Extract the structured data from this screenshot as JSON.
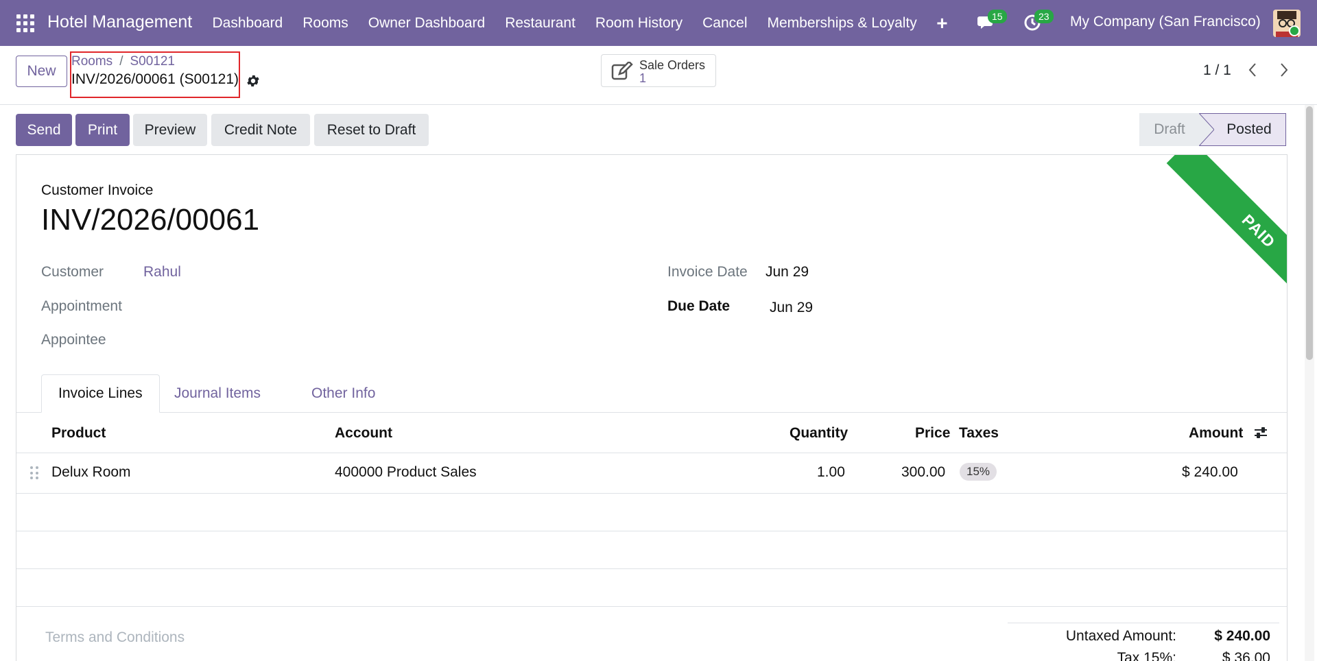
{
  "navbar": {
    "brand": "Hotel Management",
    "menu": [
      "Dashboard",
      "Rooms",
      "Owner Dashboard",
      "Restaurant",
      "Room History",
      "Cancel",
      "Memberships & Loyalty"
    ],
    "plus": "+",
    "messages_count": "15",
    "activities_count": "23",
    "company": "My Company (San Francisco)"
  },
  "control": {
    "new_label": "New",
    "breadcrumb": [
      "Rooms",
      "S00121"
    ],
    "record_title": "INV/2026/00061 (S00121)",
    "smart_button": {
      "label": "Sale Orders",
      "value": "1"
    },
    "pager": "1 / 1"
  },
  "actions": {
    "send": "Send",
    "print": "Print",
    "preview": "Preview",
    "credit_note": "Credit Note",
    "reset_to_draft": "Reset to Draft"
  },
  "status": {
    "draft": "Draft",
    "posted": "Posted",
    "active": "Posted"
  },
  "form": {
    "ribbon": "PAID",
    "doc_type": "Customer Invoice",
    "doc_number": "INV/2026/00061",
    "fields_left": [
      {
        "label": "Customer",
        "value": "Rahul"
      },
      {
        "label": "Appointment",
        "value": ""
      },
      {
        "label": "Appointee",
        "value": ""
      }
    ],
    "fields_right": [
      {
        "label": "Invoice Date",
        "value": "Jun 29"
      },
      {
        "label": "Due Date",
        "value": "Jun 29"
      }
    ],
    "tabs": [
      "Invoice Lines",
      "Journal Items",
      "Other Info"
    ],
    "active_tab": "Invoice Lines"
  },
  "lines": {
    "headers": [
      "Product",
      "Account",
      "Quantity",
      "Price",
      "Taxes",
      "Amount"
    ],
    "rows": [
      {
        "product": "Delux Room",
        "account": "400000 Product Sales",
        "quantity": "1.00",
        "price": "300.00",
        "taxes": "15%",
        "amount": "$ 240.00"
      }
    ]
  },
  "footer": {
    "terms_placeholder": "Terms and Conditions",
    "untaxed_label": "Untaxed Amount:",
    "untaxed_value": "$ 240.00",
    "tax_label": "Tax 15%:",
    "tax_value": "$ 36.00"
  },
  "colors": {
    "brand": "#71639e",
    "paid_ribbon": "#28a745",
    "badge": "#28a745",
    "highlight_box": "#e0262a"
  }
}
